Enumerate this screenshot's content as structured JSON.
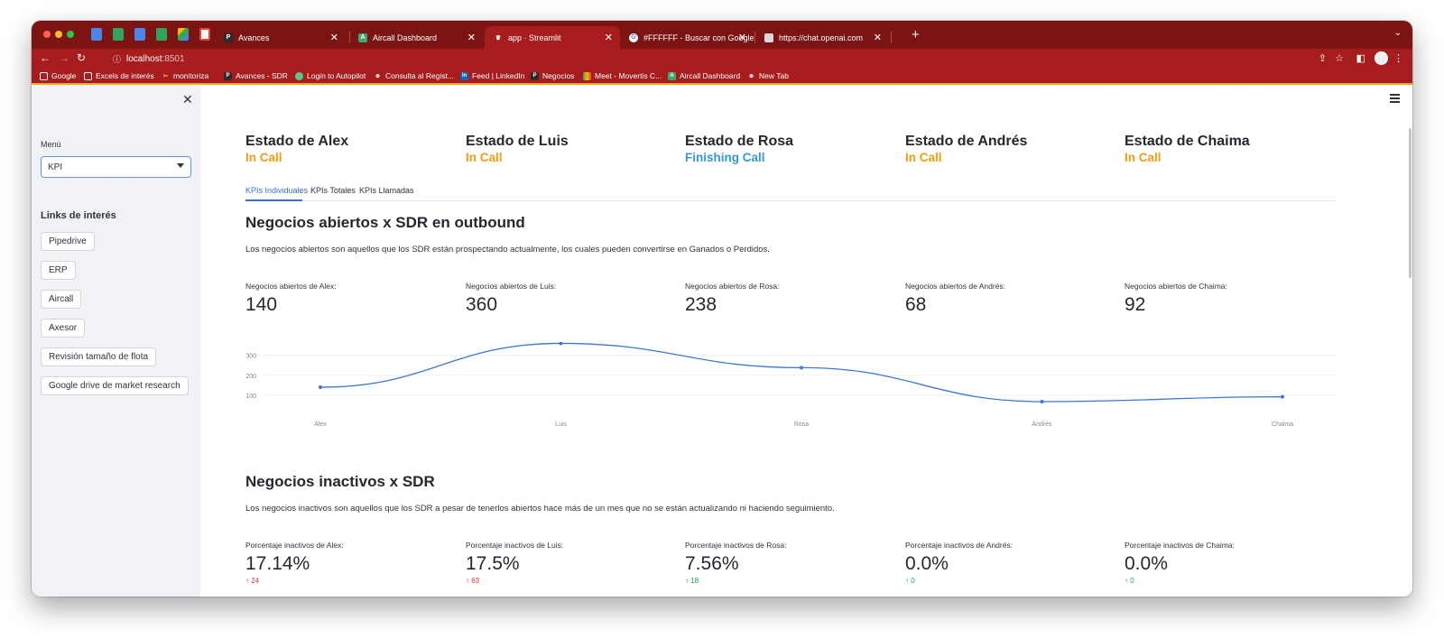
{
  "browser": {
    "tabs": [
      {
        "title": "Avances",
        "icon": "pipedrive-p-icon",
        "color": "#2b2b2b"
      },
      {
        "title": "Aircall Dashboard",
        "icon": "aircall-icon",
        "color": "#3aa86f"
      },
      {
        "title": "app · Streamlit",
        "icon": "streamlit-crown-icon",
        "color": "#ff4b4b",
        "active": true
      },
      {
        "title": "#FFFFFF - Buscar con Google",
        "icon": "google-g-icon",
        "color": "#ffffff"
      },
      {
        "title": "https://chat.openai.com",
        "icon": "page-icon",
        "color": "#d9d9d9"
      }
    ],
    "url_host": "localhost",
    "url_port": ":8501",
    "bookmarks": [
      {
        "label": "Google",
        "icon": "folder-icon"
      },
      {
        "label": "Excels de interés",
        "icon": "folder-icon"
      },
      {
        "label": "monitoriza",
        "icon": "tool-icon"
      },
      {
        "label": "Avances - SDR",
        "icon": "pipedrive-p-icon"
      },
      {
        "label": "Login to Autopilot",
        "icon": "autopilot-icon"
      },
      {
        "label": "Consulta al Regist...",
        "icon": "globe-icon"
      },
      {
        "label": "Feed | LinkedIn",
        "icon": "linkedin-icon"
      },
      {
        "label": "Negocios",
        "icon": "pipedrive-p-icon"
      },
      {
        "label": "Meet - Movertis C...",
        "icon": "meet-icon"
      },
      {
        "label": "Aircall Dashboard",
        "icon": "aircall-icon"
      },
      {
        "label": "New Tab",
        "icon": "globe-icon"
      }
    ]
  },
  "sidebar": {
    "menu_label": "Menú",
    "menu_selected": "KPI",
    "links_title": "Links de interés",
    "links": [
      "Pipedrive",
      "ERP",
      "Aircall",
      "Axesor",
      "Revisión tamaño de flota",
      "Google drive de market research"
    ]
  },
  "estados": [
    {
      "name": "Estado de Alex",
      "status": "In Call",
      "color": "#f39c12"
    },
    {
      "name": "Estado de Luis",
      "status": "In Call",
      "color": "#f39c12"
    },
    {
      "name": "Estado de Rosa",
      "status": "Finishing Call",
      "color": "#3498db"
    },
    {
      "name": "Estado de Andrés",
      "status": "In Call",
      "color": "#f39c12"
    },
    {
      "name": "Estado de Chaima",
      "status": "In Call",
      "color": "#f39c12"
    }
  ],
  "tabs": [
    "KPIs Individuales",
    "KPIs Totales",
    "KPIs Llamadas"
  ],
  "section1": {
    "title": "Negocios abiertos x SDR en outbound",
    "description": "Los negocios abiertos son aquellos que los SDR están prospectando actualmente, los cuales pueden convertirse en Ganados o Perdidos.",
    "metrics": [
      {
        "label": "Negocios abiertos de Alex:",
        "value": "140"
      },
      {
        "label": "Negocios abiertos de Luis:",
        "value": "360"
      },
      {
        "label": "Negocios abiertos de Rosa:",
        "value": "238"
      },
      {
        "label": "Negocios abiertos de Andrés:",
        "value": "68"
      },
      {
        "label": "Negocios abiertos de Chaima:",
        "value": "92"
      }
    ]
  },
  "chart_data": {
    "type": "line",
    "categories": [
      "Alex",
      "Luis",
      "Rosa",
      "Andrés",
      "Chaima"
    ],
    "values": [
      140,
      360,
      238,
      68,
      92
    ],
    "y_ticks": [
      "100",
      "200",
      "300"
    ],
    "ylim": [
      0,
      400
    ],
    "grid": true,
    "line_color": "#3c78d8"
  },
  "section2": {
    "title": "Negocios inactivos x SDR",
    "description": "Los negocios inactivos son aquellos que los SDR a pesar de tenerlos abiertos hace más de un mes que no se están actualizando ni haciendo seguimiento.",
    "metrics": [
      {
        "label": "Porcentaje inactivos de Alex:",
        "value": "17.14%",
        "delta": "↑ 24",
        "delta_color": "#e03c3c"
      },
      {
        "label": "Porcentaje inactivos de Luis:",
        "value": "17.5%",
        "delta": "↑ 63",
        "delta_color": "#e03c3c"
      },
      {
        "label": "Porcentaje inactivos de Rosa:",
        "value": "7.56%",
        "delta": "↑ 18",
        "delta_color": "#21a152"
      },
      {
        "label": "Porcentaje inactivos de Andrés:",
        "value": "0.0%",
        "delta": "↑ 0",
        "delta_color": "#21a152"
      },
      {
        "label": "Porcentaje inactivos de Chaima:",
        "value": "0.0%",
        "delta": "↑ 0",
        "delta_color": "#21a152"
      }
    ]
  }
}
